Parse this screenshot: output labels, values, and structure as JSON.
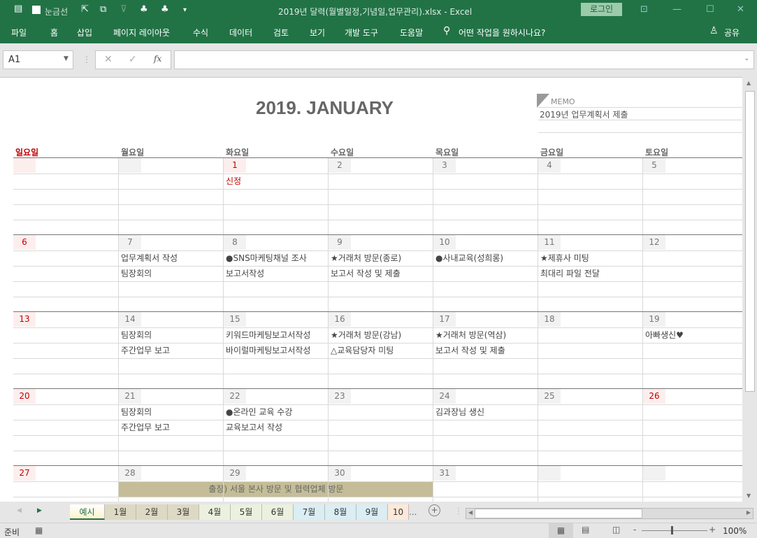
{
  "titlebar": {
    "gridlines_label": "눈금선",
    "title": "2019년 달력(월별일정,기념일,업무관리).xlsx  -  Excel",
    "login": "로그인"
  },
  "ribbon": {
    "tabs": [
      "파일",
      "홈",
      "삽입",
      "페이지 레이아웃",
      "수식",
      "데이터",
      "검토",
      "보기",
      "개발 도구",
      "도움말"
    ],
    "search": "어떤 작업을 원하시나요?",
    "share": "공유"
  },
  "formula": {
    "name_box": "A1",
    "fx": "fx",
    "value": ""
  },
  "calendar": {
    "title": "2019. JANUARY",
    "memo_label": "MEMO",
    "memo_lines": [
      "2019년 업무계획서 제출"
    ],
    "weekdays": [
      "일요일",
      "월요일",
      "화요일",
      "수요일",
      "목요일",
      "금요일",
      "토요일"
    ],
    "weeks": [
      [
        {
          "n": "",
          "red": true,
          "ev": []
        },
        {
          "n": "",
          "ev": []
        },
        {
          "n": "1",
          "red": true,
          "ev": [
            "신정"
          ],
          "evred": true
        },
        {
          "n": "2",
          "ev": []
        },
        {
          "n": "3",
          "ev": []
        },
        {
          "n": "4",
          "ev": []
        },
        {
          "n": "5",
          "ev": []
        }
      ],
      [
        {
          "n": "6",
          "red": true,
          "ev": []
        },
        {
          "n": "7",
          "ev": [
            "업무계획서 작성",
            "팀장회의"
          ]
        },
        {
          "n": "8",
          "ev": [
            "●SNS마케팅채널 조사",
            "보고서작성"
          ]
        },
        {
          "n": "9",
          "ev": [
            "★거래처 방문(종로)",
            "보고서 작성 및 제출"
          ]
        },
        {
          "n": "10",
          "ev": [
            "●사내교육(성희롱)"
          ]
        },
        {
          "n": "11",
          "ev": [
            "★제휴사 미팅",
            "최대리 파일 전달"
          ]
        },
        {
          "n": "12",
          "ev": []
        }
      ],
      [
        {
          "n": "13",
          "red": true,
          "ev": []
        },
        {
          "n": "14",
          "ev": [
            "팀장회의",
            "주간업무 보고"
          ]
        },
        {
          "n": "15",
          "ev": [
            "키워드마케팅보고서작성",
            "바이럴마케팅보고서작성"
          ]
        },
        {
          "n": "16",
          "ev": [
            "★거래처 방문(강남)",
            "△교육담당자 미팅"
          ]
        },
        {
          "n": "17",
          "ev": [
            "★거래처 방문(역삼)",
            "보고서 작성 및 제출"
          ]
        },
        {
          "n": "18",
          "ev": []
        },
        {
          "n": "19",
          "ev": [
            "아빠생신♥"
          ]
        }
      ],
      [
        {
          "n": "20",
          "red": true,
          "ev": []
        },
        {
          "n": "21",
          "ev": [
            "팀장회의",
            "주간업무 보고"
          ]
        },
        {
          "n": "22",
          "ev": [
            "●온라인 교육 수강",
            "교육보고서 작성"
          ]
        },
        {
          "n": "23",
          "ev": []
        },
        {
          "n": "24",
          "ev": [
            "김과장님 생신"
          ]
        },
        {
          "n": "25",
          "ev": []
        },
        {
          "n": "26",
          "red": true,
          "ev": []
        }
      ],
      [
        {
          "n": "27",
          "red": true,
          "ev": []
        },
        {
          "n": "28",
          "ev": []
        },
        {
          "n": "29",
          "ev": []
        },
        {
          "n": "30",
          "ev": []
        },
        {
          "n": "31",
          "ev": []
        },
        {
          "n": "",
          "ev": []
        },
        {
          "n": "",
          "ev": []
        }
      ]
    ],
    "trip_bar": "출장) 서울 본사 방문 및 협력업체 방문"
  },
  "sheet_tabs": [
    {
      "label": "예시",
      "color": "#fff2cc",
      "active": true
    },
    {
      "label": "1월",
      "color": "#ddd9c3"
    },
    {
      "label": "2월",
      "color": "#ddd9c3"
    },
    {
      "label": "3월",
      "color": "#ddd9c3"
    },
    {
      "label": "4월",
      "color": "#ebf1de"
    },
    {
      "label": "5월",
      "color": "#ebf1de"
    },
    {
      "label": "6월",
      "color": "#ebf1de"
    },
    {
      "label": "7월",
      "color": "#daeef3"
    },
    {
      "label": "8월",
      "color": "#daeef3"
    },
    {
      "label": "9월",
      "color": "#daeef3"
    },
    {
      "label": "10",
      "color": "#fde9d9"
    }
  ],
  "more_tabs": "...",
  "status": {
    "ready": "준비",
    "zoom": "100%"
  },
  "colors": {
    "excel_green": "#217346",
    "red": "#c00000",
    "trip_bar": "#c4bd97"
  }
}
